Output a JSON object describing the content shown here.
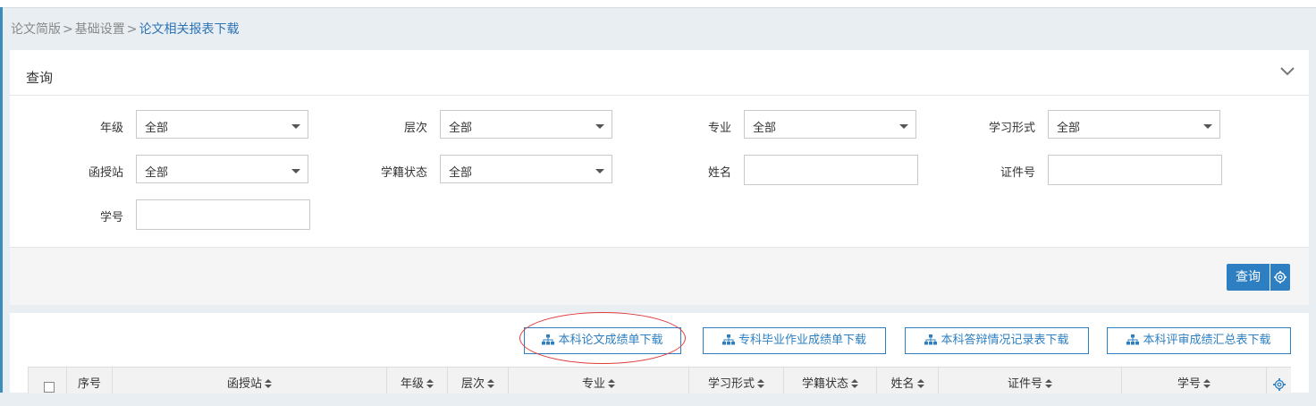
{
  "breadcrumb": {
    "item1": "论文简版",
    "item2": "基础设置",
    "current": "论文相关报表下载",
    "separator": ">"
  },
  "query_panel": {
    "title": "查询",
    "fields": {
      "grade": {
        "label": "年级",
        "value": "全部"
      },
      "level": {
        "label": "层次",
        "value": "全部"
      },
      "major": {
        "label": "专业",
        "value": "全部"
      },
      "study_form": {
        "label": "学习形式",
        "value": "全部"
      },
      "station": {
        "label": "函授站",
        "value": "全部"
      },
      "status": {
        "label": "学籍状态",
        "value": "全部"
      },
      "name": {
        "label": "姓名",
        "value": ""
      },
      "id_number": {
        "label": "证件号",
        "value": ""
      },
      "student_no": {
        "label": "学号",
        "value": ""
      }
    },
    "search_button": "查询"
  },
  "downloads": {
    "btn1": "本科论文成绩单下载",
    "btn2": "专科毕业作业成绩单下载",
    "btn3": "本科答辩情况记录表下载",
    "btn4": "本科评审成绩汇总表下载"
  },
  "table": {
    "columns": [
      "序号",
      "函授站",
      "年级",
      "层次",
      "专业",
      "学习形式",
      "学籍状态",
      "姓名",
      "证件号",
      "学号"
    ]
  },
  "colors": {
    "accent": "#2d7fc1",
    "highlight_circle": "#e03b3b"
  },
  "icons": [
    "chevron-down-icon",
    "sitemap-icon",
    "gear-icon",
    "caret-down-icon",
    "sort-icon"
  ]
}
